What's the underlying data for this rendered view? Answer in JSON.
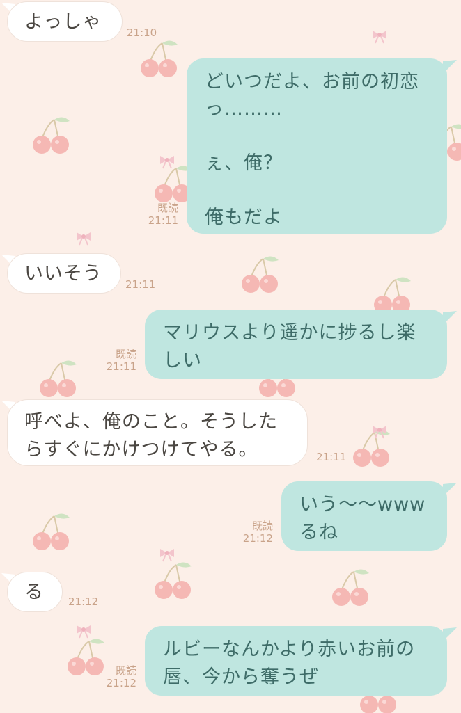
{
  "colors": {
    "background": "#fcefe8",
    "incoming_bubble": "#ffffff",
    "outgoing_bubble": "#bfe6e0",
    "outgoing_text": "#3e6c68",
    "incoming_text": "#4b4742",
    "meta_text": "#c9a38a"
  },
  "wallpaper": {
    "pattern": "cherry-icon"
  },
  "messages": [
    {
      "side": "in",
      "text": "よっしゃ",
      "time": "21:10"
    },
    {
      "side": "out",
      "text": "どいつだよ、お前の初恋\nっ………\n\nぇ、俺？\n\n俺もだよ",
      "read": "既読",
      "time": "21:11"
    },
    {
      "side": "in",
      "text": "いいそう",
      "time": "21:11"
    },
    {
      "side": "out",
      "text": "マリウスより遥かに捗るし楽\nしい",
      "read": "既読",
      "time": "21:11"
    },
    {
      "side": "in",
      "text": "呼べよ、俺のこと。そうした\nらすぐにかけつけてやる。",
      "time": "21:11"
    },
    {
      "side": "out",
      "text": "いう〜〜www\nるね",
      "read": "既読",
      "time": "21:12"
    },
    {
      "side": "in",
      "text": "る",
      "time": "21:12"
    },
    {
      "side": "out",
      "text": "ルビーなんかより赤いお前の\n唇、今から奪うぜ",
      "read": "既読",
      "time": "21:12"
    }
  ]
}
